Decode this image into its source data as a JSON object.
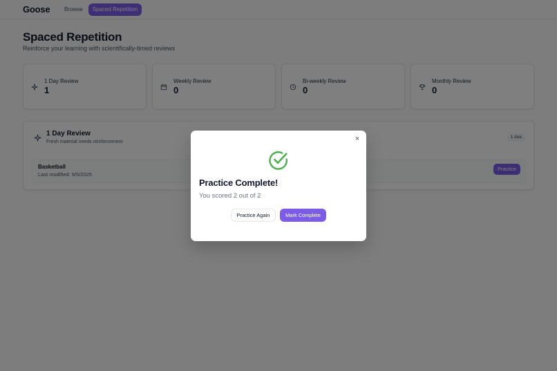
{
  "nav": {
    "logo": "Goose",
    "links": [
      {
        "label": "Browse"
      },
      {
        "label": "Spaced Repetition",
        "active": true
      }
    ]
  },
  "header": {
    "title": "Spaced Repetition",
    "subtitle": "Reinforce your learning with scientifically-timed reviews"
  },
  "stats": [
    {
      "label": "1 Day Review",
      "value": "1",
      "icon": "sparkle-icon"
    },
    {
      "label": "Weekly Review",
      "value": "0",
      "icon": "calendar-icon"
    },
    {
      "label": "Bi-weekly Review",
      "value": "0",
      "icon": "clock-icon"
    },
    {
      "label": "Monthly Review",
      "value": "0",
      "icon": "trophy-icon"
    }
  ],
  "review_section": {
    "title": "1 Day Review",
    "description": "Fresh material needs reinforcement",
    "badge": "1 due",
    "items": [
      {
        "name": "Basketball",
        "modified": "Last modified: 9/5/2025",
        "action": "Practice"
      }
    ]
  },
  "modal": {
    "title": "Practice Complete!",
    "score_text": "You scored 2 out of 2",
    "secondary_button": "Practice Again",
    "primary_button": "Mark Complete",
    "close_glyph": "×",
    "icon": "check-circle-icon"
  },
  "colors": {
    "accent": "#7c5ce6",
    "success": "#4caf50",
    "overlay": "rgba(0,0,0,0.5)"
  }
}
